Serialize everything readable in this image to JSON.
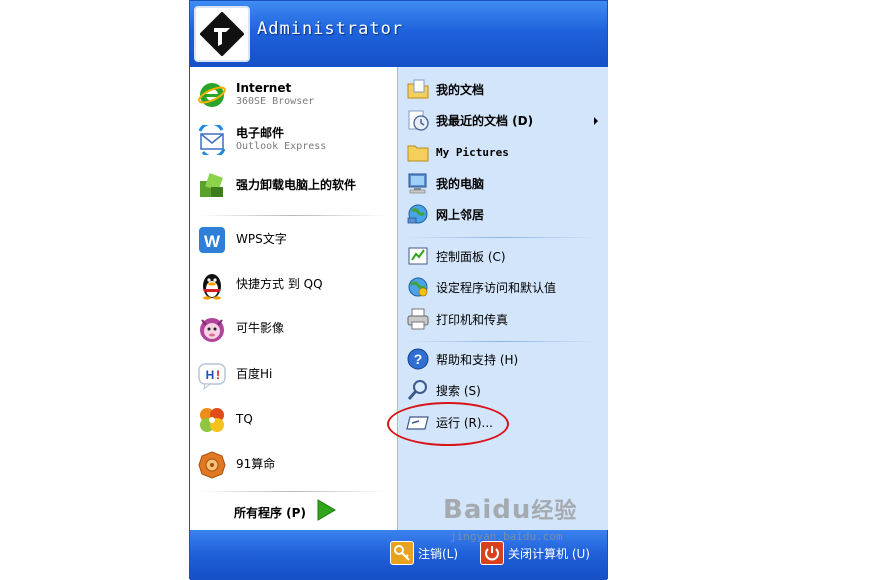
{
  "user": {
    "name": "Administrator"
  },
  "pinned": [
    {
      "label": "Internet",
      "sub": "360SE Browser",
      "icon": "ie-browser-icon"
    },
    {
      "label": "电子邮件",
      "sub": "Outlook Express",
      "icon": "outlook-icon"
    }
  ],
  "recent": [
    {
      "label": "强力卸载电脑上的软件",
      "icon": "uninstaller-icon"
    },
    {
      "label": "WPS文字",
      "icon": "wps-icon"
    },
    {
      "label": "快捷方式 到 QQ",
      "icon": "qq-penguin-icon"
    },
    {
      "label": "可牛影像",
      "icon": "keniu-image-icon"
    },
    {
      "label": "百度Hi",
      "icon": "baidu-hi-icon"
    },
    {
      "label": "TQ",
      "icon": "tq-icon"
    },
    {
      "label": "91算命",
      "icon": "fortune-icon"
    }
  ],
  "all_programs": {
    "label": "所有程序 (P)"
  },
  "places": [
    {
      "label": "我的文档",
      "icon": "my-documents-icon"
    },
    {
      "label": "我最近的文档 (D)",
      "icon": "recent-documents-icon"
    },
    {
      "label": "My Pictures",
      "icon": "my-pictures-icon"
    },
    {
      "label": "我的电脑",
      "icon": "my-computer-icon"
    },
    {
      "label": "网上邻居",
      "icon": "network-places-icon"
    }
  ],
  "system": [
    {
      "label": "控制面板 (C)",
      "icon": "control-panel-icon"
    },
    {
      "label": "设定程序访问和默认值",
      "icon": "program-defaults-icon"
    },
    {
      "label": "打印机和传真",
      "icon": "printer-icon"
    }
  ],
  "tools": [
    {
      "label": "帮助和支持 (H)",
      "icon": "help-icon"
    },
    {
      "label": "搜索 (S)",
      "icon": "search-icon"
    },
    {
      "label": "运行 (R)...",
      "icon": "run-icon"
    }
  ],
  "footer": {
    "logoff": "注销(L)",
    "shutdown": "关闭计算机 (U)"
  },
  "watermark": {
    "brand": "Bai",
    "brand2": "du",
    "suffix": "经验",
    "url": "jingyan.baidu.com"
  },
  "colors": {
    "header_blue": "#1f63dc",
    "right_pane": "#d3e5fa",
    "highlight_circle": "#d8141a"
  }
}
